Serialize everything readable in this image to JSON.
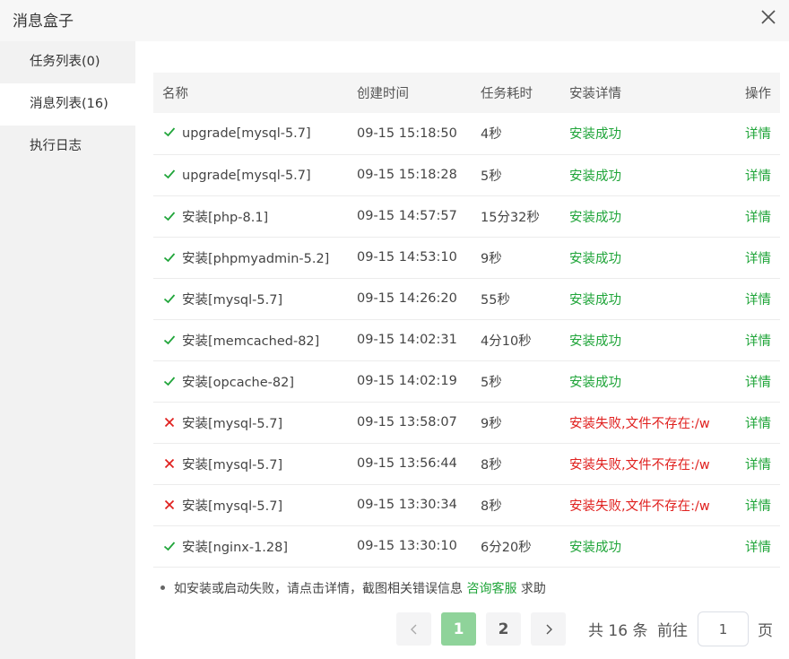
{
  "dialog": {
    "title": "消息盒子"
  },
  "sidebar": {
    "items": [
      {
        "label": "任务列表(0)"
      },
      {
        "label": "消息列表(16)"
      },
      {
        "label": "执行日志"
      }
    ]
  },
  "table": {
    "headers": {
      "name": "名称",
      "created": "创建时间",
      "duration": "任务耗时",
      "detail": "安装详情",
      "action": "操作"
    },
    "rows": [
      {
        "status": "success",
        "name": "upgrade[mysql-5.7]",
        "created": "09-15 15:18:50",
        "duration": "4秒",
        "detail": "安装成功",
        "action": "详情"
      },
      {
        "status": "success",
        "name": "upgrade[mysql-5.7]",
        "created": "09-15 15:18:28",
        "duration": "5秒",
        "detail": "安装成功",
        "action": "详情"
      },
      {
        "status": "success",
        "name": "安装[php-8.1]",
        "created": "09-15 14:57:57",
        "duration": "15分32秒",
        "detail": "安装成功",
        "action": "详情"
      },
      {
        "status": "success",
        "name": "安装[phpmyadmin-5.2]",
        "created": "09-15 14:53:10",
        "duration": "9秒",
        "detail": "安装成功",
        "action": "详情"
      },
      {
        "status": "success",
        "name": "安装[mysql-5.7]",
        "created": "09-15 14:26:20",
        "duration": "55秒",
        "detail": "安装成功",
        "action": "详情"
      },
      {
        "status": "success",
        "name": "安装[memcached-82]",
        "created": "09-15 14:02:31",
        "duration": "4分10秒",
        "detail": "安装成功",
        "action": "详情"
      },
      {
        "status": "success",
        "name": "安装[opcache-82]",
        "created": "09-15 14:02:19",
        "duration": "5秒",
        "detail": "安装成功",
        "action": "详情"
      },
      {
        "status": "fail",
        "name": "安装[mysql-5.7]",
        "created": "09-15 13:58:07",
        "duration": "9秒",
        "detail": "安装失败,文件不存在:/w",
        "action": "详情"
      },
      {
        "status": "fail",
        "name": "安装[mysql-5.7]",
        "created": "09-15 13:56:44",
        "duration": "8秒",
        "detail": "安装失败,文件不存在:/w",
        "action": "详情"
      },
      {
        "status": "fail",
        "name": "安装[mysql-5.7]",
        "created": "09-15 13:30:34",
        "duration": "8秒",
        "detail": "安装失败,文件不存在:/w",
        "action": "详情"
      },
      {
        "status": "success",
        "name": "安装[nginx-1.28]",
        "created": "09-15 13:30:10",
        "duration": "6分20秒",
        "detail": "安装成功",
        "action": "详情"
      }
    ]
  },
  "tip": {
    "text": "如安装或启动失败，请点击详情，截图相关错误信息",
    "link": "咨询客服",
    "suffix": "求助"
  },
  "pagination": {
    "pages": [
      "1",
      "2"
    ],
    "current": "1",
    "total_text": "共 16 条",
    "goto_label": "前往",
    "goto_value": "1",
    "page_unit": "页"
  },
  "colors": {
    "success": "#20a53a",
    "fail": "#e0211f",
    "accent": "#20a53a"
  }
}
